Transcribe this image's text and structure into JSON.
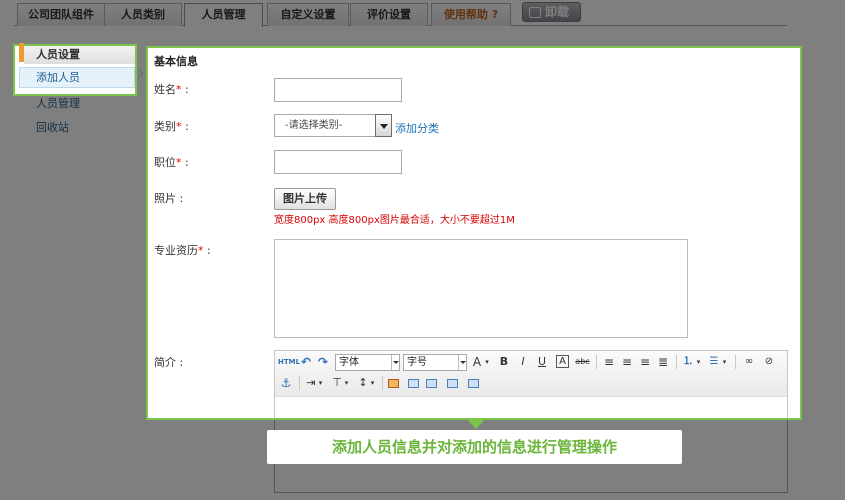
{
  "tabs": [
    {
      "label": "公司团队组件",
      "active": false
    },
    {
      "label": "人员类别",
      "active": false
    },
    {
      "label": "人员管理",
      "active": true
    },
    {
      "label": "自定义设置",
      "active": false
    },
    {
      "label": "评价设置",
      "active": false
    },
    {
      "label": "使用帮助 ?",
      "active": false
    }
  ],
  "uninstall_label": "卸载",
  "sidebar": {
    "section_title": "人员设置",
    "items": [
      "添加人员",
      "人员管理",
      "回收站"
    ]
  },
  "form": {
    "section_title": "基本信息",
    "name_label": "姓名",
    "category_label": "类别",
    "category_selected": "-请选择类别-",
    "add_category_link": "添加分类",
    "position_label": "职位",
    "photo_label": "照片 :",
    "upload_button": "图片上传",
    "photo_hint": "宽度800px 高度800px图片最合适，大小不要超过1M",
    "qualification_label": "专业资历",
    "intro_label": "简介 :",
    "required_mark": "*",
    "colon": " :"
  },
  "editor_toolbar": {
    "html_label": "HTML",
    "font_family": "字体",
    "font_size": "字号",
    "font_color_label": "A",
    "bold": "B",
    "italic": "I",
    "underline": "U",
    "bordered_a": "A",
    "strike": "abc"
  },
  "caption": "添加人员信息并对添加的信息进行管理操作",
  "colors": {
    "highlight": "#7bc64a",
    "overlay": "#7f7f7f",
    "required": "#e00000",
    "link": "#1f73b7",
    "active_marker": "#f39b2a"
  }
}
